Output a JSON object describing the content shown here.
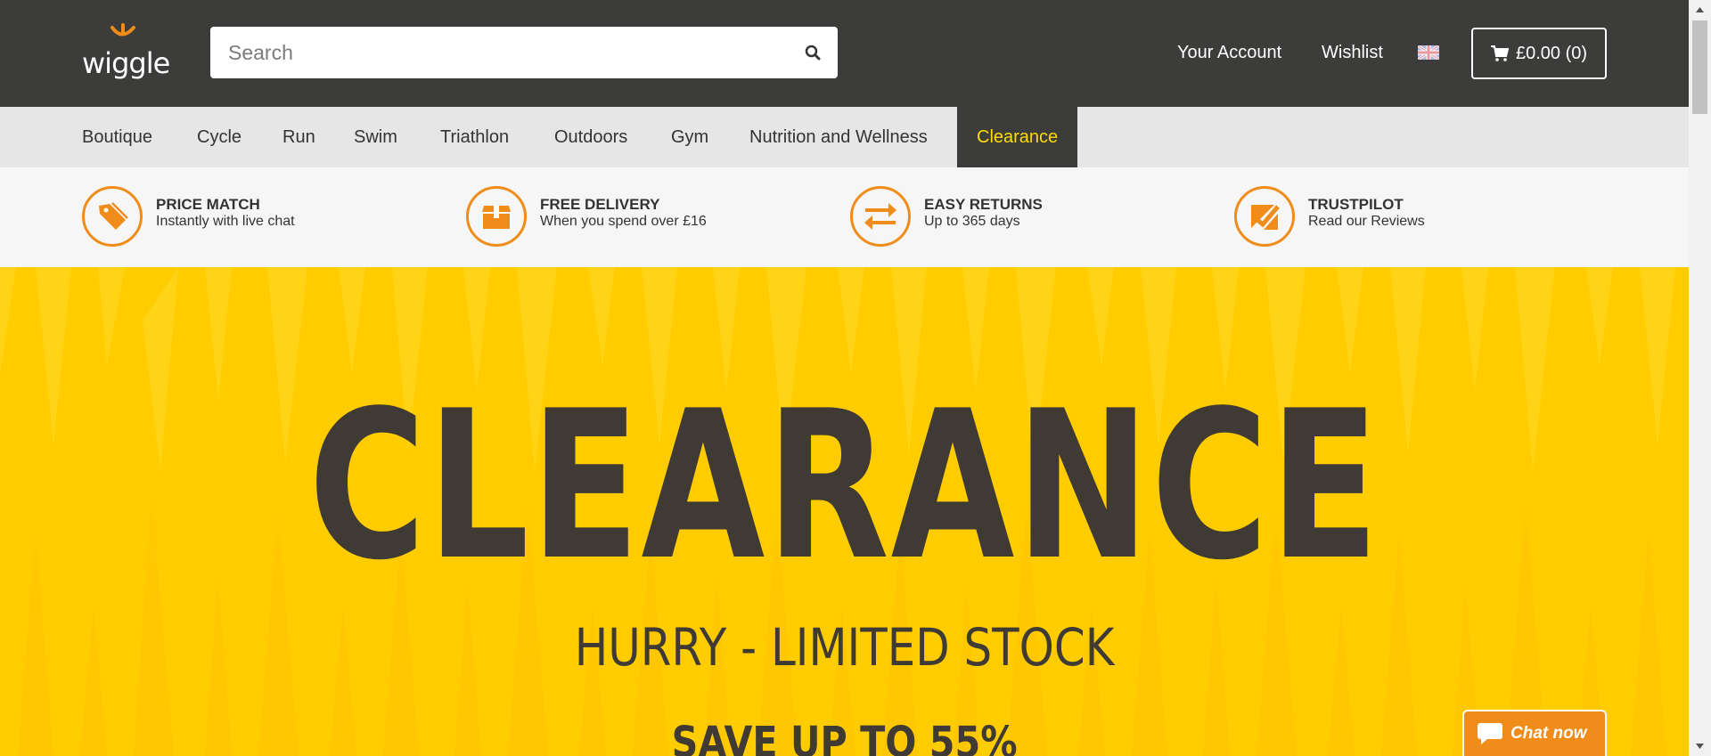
{
  "header": {
    "logo_text": "wiggle",
    "search_placeholder": "Search",
    "links": {
      "account": "Your Account",
      "wishlist": "Wishlist"
    },
    "language_flag": "uk-flag-icon",
    "cart_label": "£0.00 (0)"
  },
  "nav": {
    "items": [
      {
        "label": "Boutique"
      },
      {
        "label": "Cycle"
      },
      {
        "label": "Run"
      },
      {
        "label": "Swim"
      },
      {
        "label": "Triathlon"
      },
      {
        "label": "Outdoors"
      },
      {
        "label": "Gym"
      },
      {
        "label": "Nutrition and Wellness"
      },
      {
        "label": "Clearance"
      }
    ],
    "active": "Clearance"
  },
  "usps": [
    {
      "icon": "price-tag-icon",
      "title": "PRICE MATCH",
      "subtitle": "Instantly with live chat"
    },
    {
      "icon": "delivery-box-icon",
      "title": "FREE DELIVERY",
      "subtitle": "When you spend over £16"
    },
    {
      "icon": "returns-arrows-icon",
      "title": "EASY RETURNS",
      "subtitle": "Up to 365 days"
    },
    {
      "icon": "trustpilot-icon",
      "title": "TRUSTPILOT",
      "subtitle": "Read our Reviews"
    }
  ],
  "hero": {
    "title": "CLEARANCE",
    "subtitle": "HURRY - LIMITED STOCK",
    "save_text": "SAVE UP TO 55%"
  },
  "chat": {
    "label": "Chat now"
  },
  "colors": {
    "header_bg": "#3c3c3a",
    "nav_bg": "#e6e6e6",
    "accent_orange": "#f08c1a",
    "active_nav_text": "#ffdb00",
    "hero_yellow": "#ffcc00",
    "hero_text": "#3f3a33"
  }
}
